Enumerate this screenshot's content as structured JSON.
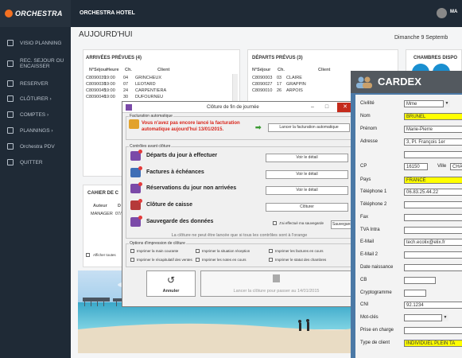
{
  "app": {
    "logo_text": "ORCHESTRA",
    "hotel": "ORCHESTRA HOTEL",
    "user": "MA"
  },
  "sidebar": {
    "items": [
      {
        "label": "VISIO PLANNING",
        "icon": "calendar-icon"
      },
      {
        "label": "REC. SEJOUR OU ENCAISSER",
        "icon": "cash-register-icon"
      },
      {
        "label": "RESERVER",
        "icon": "bed-icon"
      },
      {
        "label": "CLÔTURER ›",
        "icon": "close-day-icon"
      },
      {
        "label": "COMPTES ›",
        "icon": "users-icon"
      },
      {
        "label": "PLANNINGS ›",
        "icon": "planning-icon"
      },
      {
        "label": "Orchestra PDV",
        "icon": "pos-icon"
      },
      {
        "label": "QUITTER",
        "icon": "exit-icon"
      }
    ]
  },
  "page": {
    "title": "AUJOURD'HUI",
    "date": "Dimanche 9 Septemb"
  },
  "arrivals": {
    "title": "ARRIVÉES PRÉVUES (4)",
    "headers": [
      "N°Séjour",
      "Heure",
      "Ch.",
      "Client"
    ],
    "rows": [
      [
        "C8090039",
        "19:00",
        "04",
        "GRINCHEUX"
      ],
      [
        "C8090038",
        "19:00",
        "07",
        "LEOTARD"
      ],
      [
        "C8090045",
        "19:00",
        "24",
        "CARPENTIERA"
      ],
      [
        "C8090046",
        "19:00",
        "30",
        "DUFOURNEU"
      ]
    ]
  },
  "departures": {
    "title": "DÉPARTS PRÉVUS (3)",
    "headers": [
      "N°Séjour",
      "Ch.",
      "Client"
    ],
    "rows": [
      [
        "C8090003",
        "03",
        "CLAIRE"
      ],
      [
        "C8090027",
        "17",
        "GRAPPIN"
      ],
      [
        "C8090010",
        "26",
        "ARPOIS"
      ]
    ]
  },
  "rooms": {
    "title": "CHAMBRES DISPO"
  },
  "cahier": {
    "title": "CAHIER DE C",
    "headers": [
      "Auteur",
      "D"
    ],
    "row": [
      "MANAGER",
      "07/"
    ],
    "show_all": "Afficher toutes"
  },
  "dialog": {
    "title": "Clôture de fin de journée",
    "fact_group": "Facturation automatique",
    "warning": "Vous n'avez pas encore lancé la facturation automatique aujourd'hui 13/01/2015.",
    "launch_fact": "Lancer la facturation automatique",
    "controls_group": "Contrôles avant clôture",
    "items": [
      {
        "label": "Départs du jour à effectuer",
        "action": "Voir le détail"
      },
      {
        "label": "Factures à échéances",
        "action": "Voir le détail"
      },
      {
        "label": "Réservations du jour non arrivées",
        "action": "Voir le détail"
      },
      {
        "label": "Clôture de caisse",
        "action": "Clôturer"
      },
      {
        "label": "Sauvegarde des données",
        "action": "Sauvegard"
      }
    ],
    "backup_check": "J'ai effectué ma sauvegarde",
    "note": "La clôture ne peut être lancée que si tous les contrôles sont à l'orange",
    "print_group": "Options d'impression de clôture",
    "print_opts": [
      "Imprimer la main courante",
      "Imprimer la situation réception",
      "Imprimer les factures en cours",
      "Imprimer le récapitulatif des ventes",
      "Imprimer les notes en cours",
      "Imprimer le statut des chambres"
    ],
    "cancel": "Annuler",
    "launch": "Lancer la clôture pour passer au 14/01/2015"
  },
  "cardex": {
    "title": "CARDEX",
    "fields": [
      {
        "label": "Civilité",
        "value": "Mme",
        "hl": false,
        "w": 58,
        "drop": true
      },
      {
        "label": "Nom",
        "value": "BRUNEL",
        "hl": true,
        "w": 74
      },
      {
        "label": "Prénom",
        "value": "Marie-Pierre",
        "hl": false,
        "w": 74
      },
      {
        "label": "Adresse",
        "value": "3, Pl. François 1er",
        "hl": false,
        "w": 74
      },
      {
        "label": "",
        "value": "",
        "hl": false,
        "w": 74
      },
      {
        "label": "CP",
        "value": "16150",
        "hl": false,
        "w": 30,
        "extra_label": "Ville",
        "extra_value": "CHA"
      },
      {
        "label": "Pays",
        "value": "FRANCE",
        "hl": true,
        "w": 74
      },
      {
        "label": "Téléphone 1",
        "value": "06.83.25.44.22",
        "hl": false,
        "w": 74
      },
      {
        "label": "Téléphone 2",
        "value": "",
        "hl": false,
        "w": 74
      },
      {
        "label": "Fax",
        "value": "",
        "hl": false,
        "w": 74
      },
      {
        "label": "TVA Intra",
        "value": "",
        "hl": false,
        "w": 74
      },
      {
        "label": "E-Mail",
        "value": "tech.ecolix@elix.fr",
        "hl": false,
        "w": 74
      },
      {
        "label": "E-Mail 2",
        "value": "",
        "hl": false,
        "w": 74
      },
      {
        "label": "Date naissance",
        "value": "",
        "hl": false,
        "w": 74
      },
      {
        "label": "CB",
        "value": "",
        "hl": false,
        "w": 40
      },
      {
        "label": "Cryptogramme",
        "value": "",
        "hl": false,
        "w": 28
      },
      {
        "label": "CNI",
        "value": "92.1234",
        "hl": false,
        "w": 74
      },
      {
        "label": "Mot-clés",
        "value": "",
        "hl": false,
        "w": 56,
        "drop": true
      },
      {
        "label": "Prise en charge",
        "value": "",
        "hl": false,
        "w": 74
      },
      {
        "label": "Type de client",
        "value": "INDIVIDUEL PLEIN TA",
        "hl": true,
        "w": 74
      }
    ]
  },
  "colors": {
    "sidebar": "#1f2a36",
    "accent": "#f37021",
    "cardex": "#4b79a6",
    "warning": "#d9261c",
    "highlight": "#ffff00"
  }
}
